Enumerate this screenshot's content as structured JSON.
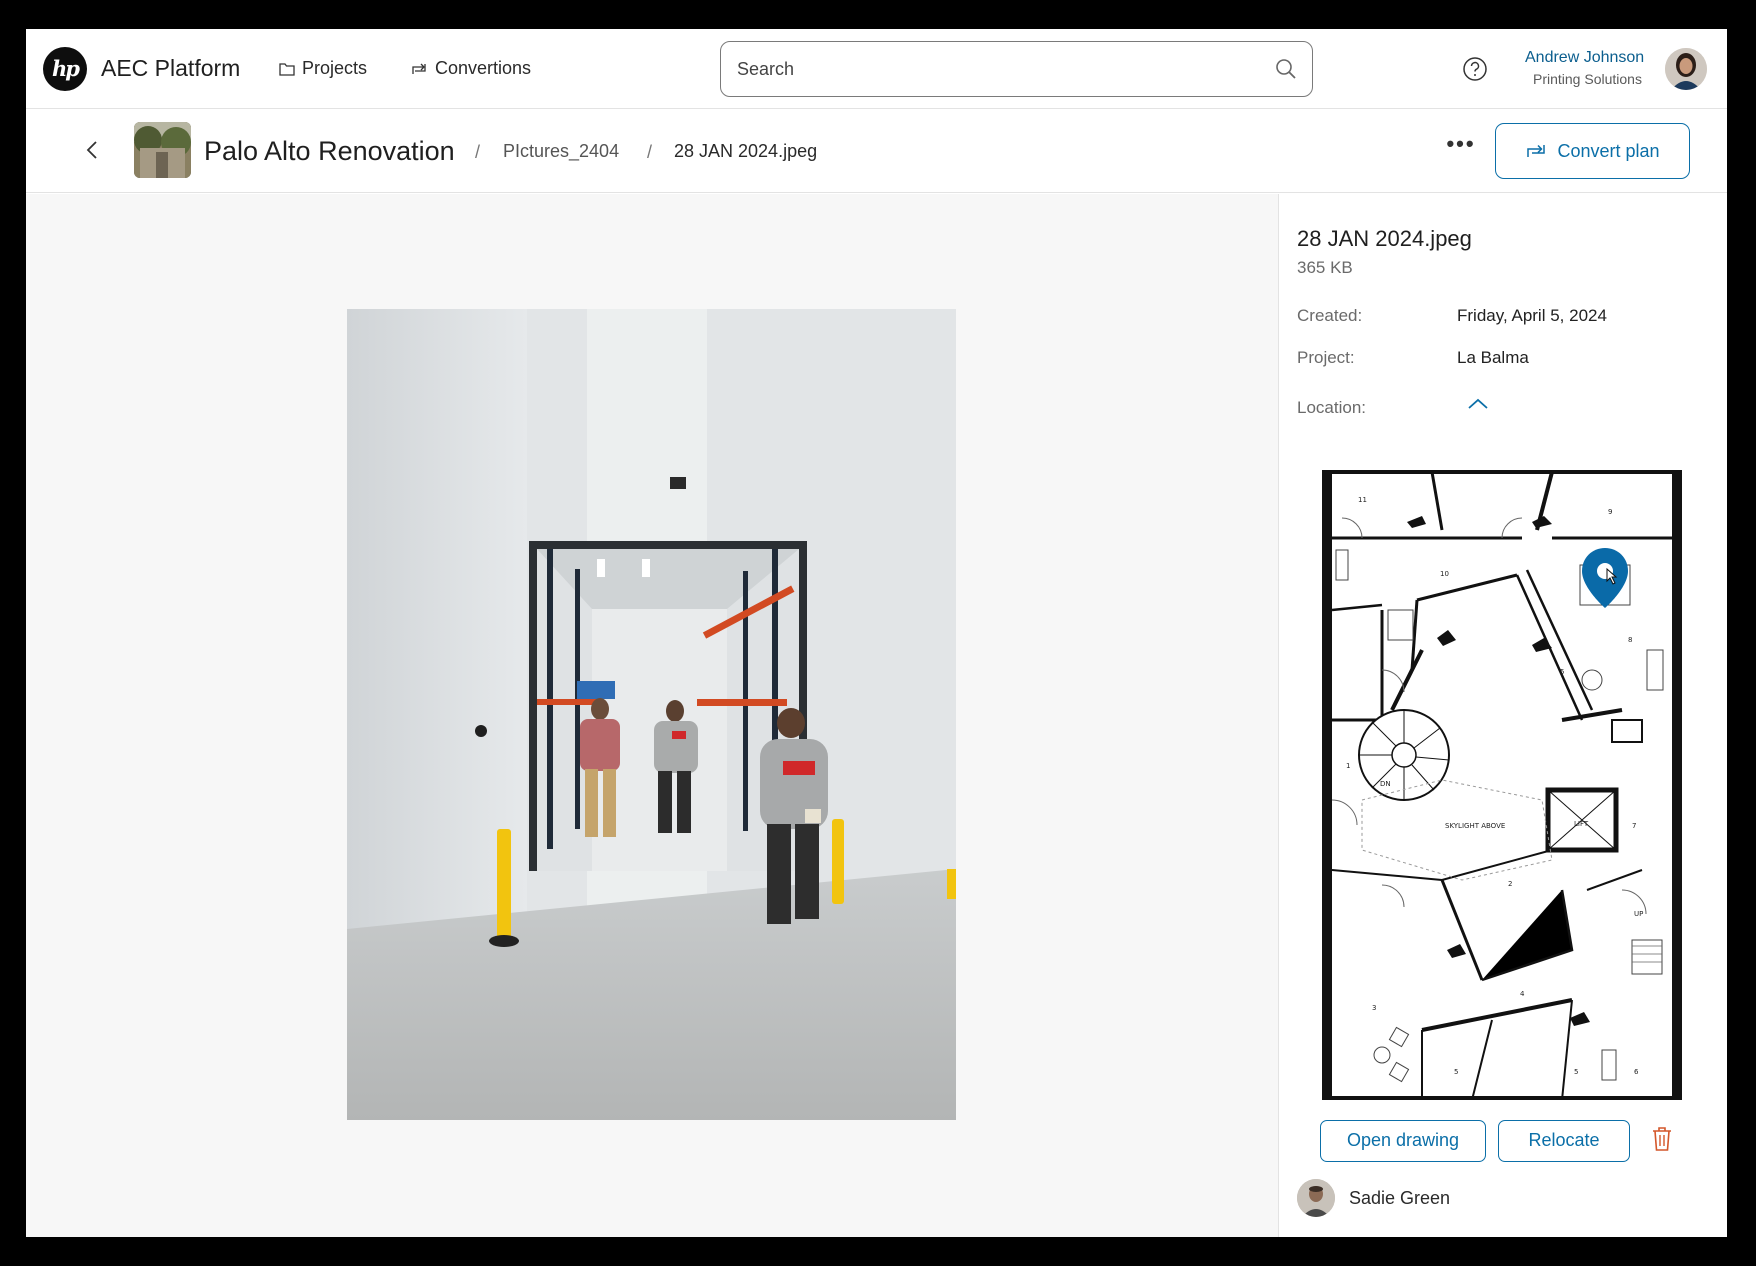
{
  "app": {
    "logo_text": "hp",
    "title": "AEC Platform"
  },
  "nav": {
    "projects_label": "Projects",
    "conversions_label": "Convertions"
  },
  "search": {
    "placeholder": "Search"
  },
  "user": {
    "name": "Andrew Johnson",
    "organization": "Printing Solutions"
  },
  "breadcrumb": {
    "project": "Palo Alto Renovation",
    "separator": "/",
    "folder": "PIctures_2404",
    "file": "28 JAN 2024.jpeg"
  },
  "toolbar": {
    "more_label": "•••",
    "convert_label": "Convert plan"
  },
  "details": {
    "file_name": "28 JAN 2024.jpeg",
    "file_size": "365 KB",
    "created_label": "Created:",
    "created_value": "Friday, April 5, 2024",
    "project_label": "Project:",
    "project_value": "La Balma",
    "location_label": "Location:"
  },
  "floorplan": {
    "room_labels": [
      "11",
      "9",
      "10",
      "8",
      "5",
      "1",
      "DN",
      "SKYLIGHT ABOVE",
      "LIFT",
      "7",
      "2",
      "UP",
      "4",
      "3",
      "5",
      "5",
      "6"
    ]
  },
  "actions": {
    "open_drawing_label": "Open drawing",
    "relocate_label": "Relocate"
  },
  "author": {
    "name": "Sadie Green"
  },
  "colors": {
    "accent": "#0b6fa8",
    "user_name": "#0b5e8e",
    "delete": "#d4572a",
    "pin": "#0a6aa8"
  }
}
